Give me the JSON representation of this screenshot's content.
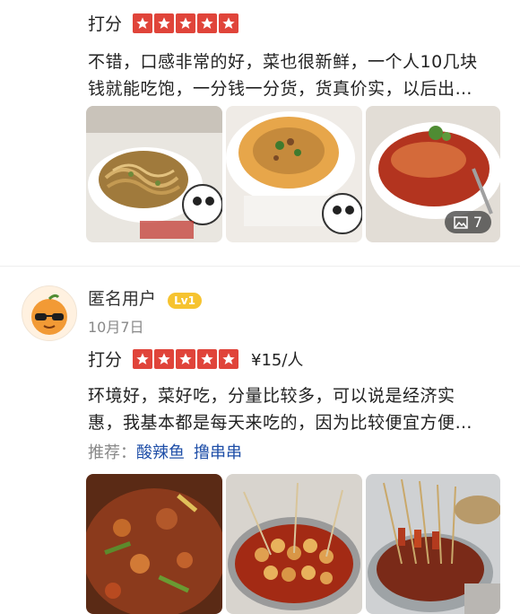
{
  "review1": {
    "rating_label": "打分",
    "stars": 5,
    "text_line1": "不错，口感非常的好，菜也很新鲜，一个人10几块",
    "text_line2": "钱就能吃饱，一分钱一分货，货真价实，以后出…",
    "photo_count": "7",
    "photos": [
      "noodles-photo",
      "steamed-egg-photo",
      "fish-photo"
    ]
  },
  "review2": {
    "username": "匿名用户",
    "level": "Lv1",
    "date": "10月7日",
    "rating_label": "打分",
    "stars": 5,
    "price": "¥15/人",
    "text_line1": "环境好，菜好吃，分量比较多，可以说是经济实",
    "text_line2": "惠，我基本都是每天来吃的，因为比较便宜方便…",
    "recommend_label": "推荐：",
    "recommend_items": [
      "酸辣鱼",
      "撸串串"
    ],
    "photos": [
      "stir-fry-photo",
      "skewer-balls-photo",
      "skewers-pot-photo"
    ]
  },
  "colors": {
    "star_red": "#e0443a",
    "link_blue": "#1f4fa8",
    "badge_yellow": "#f6c330"
  }
}
